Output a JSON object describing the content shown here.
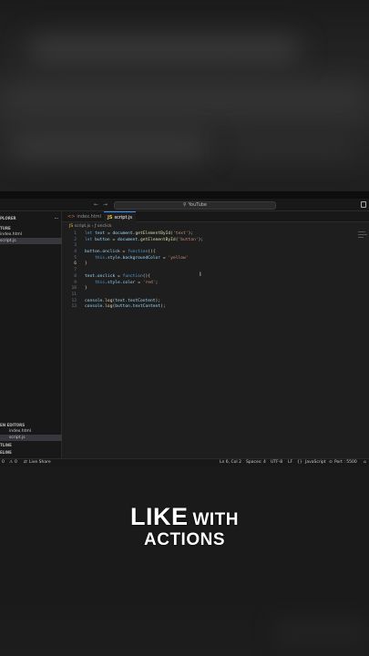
{
  "titlebar": {
    "search": "YouTube"
  },
  "sidebar": {
    "explorer_label": "PLORER",
    "folder_label": "TURE",
    "files": [
      "index.html",
      "script.js"
    ],
    "open_editors_label": "EN EDITORS",
    "open_files": [
      "index.html",
      "script.js"
    ],
    "outline_label": "TLINE",
    "timeline_label": "ELINE"
  },
  "tabs": [
    {
      "label": "index.html",
      "active": false
    },
    {
      "label": "script.js",
      "active": true
    }
  ],
  "breadcrumb": {
    "file": "script.js",
    "symbol": "onclick"
  },
  "code_lines": [
    {
      "n": "1",
      "text": "let text = document.getElementById('text');"
    },
    {
      "n": "2",
      "text": "let button = document.getElementById('button');"
    },
    {
      "n": "3",
      "text": ""
    },
    {
      "n": "4",
      "text": "button.onclick = function(){"
    },
    {
      "n": "5",
      "text": "    this.style.backgroundColor = 'yellow'"
    },
    {
      "n": "6",
      "text": "}"
    },
    {
      "n": "7",
      "text": ""
    },
    {
      "n": "8",
      "text": "text.onclick = function(){"
    },
    {
      "n": "9",
      "text": "    this.style.color = 'red';"
    },
    {
      "n": "10",
      "text": "}"
    },
    {
      "n": "11",
      "text": ""
    },
    {
      "n": "12",
      "text": "console.log(text.textContent);"
    },
    {
      "n": "13",
      "text": "console.log(button.textContent);"
    }
  ],
  "statusbar": {
    "errors": "0",
    "warnings": "0",
    "live_share": "Live Share",
    "position": "Ln 6, Col 2",
    "spaces": "Spaces: 4",
    "encoding": "UTF-8",
    "eol": "LF",
    "language": "JavaScript",
    "port": "Port : 5500"
  },
  "caption": {
    "line1_big": "LIKE",
    "line1_small": "WITH",
    "line2": "ACTIONS"
  }
}
